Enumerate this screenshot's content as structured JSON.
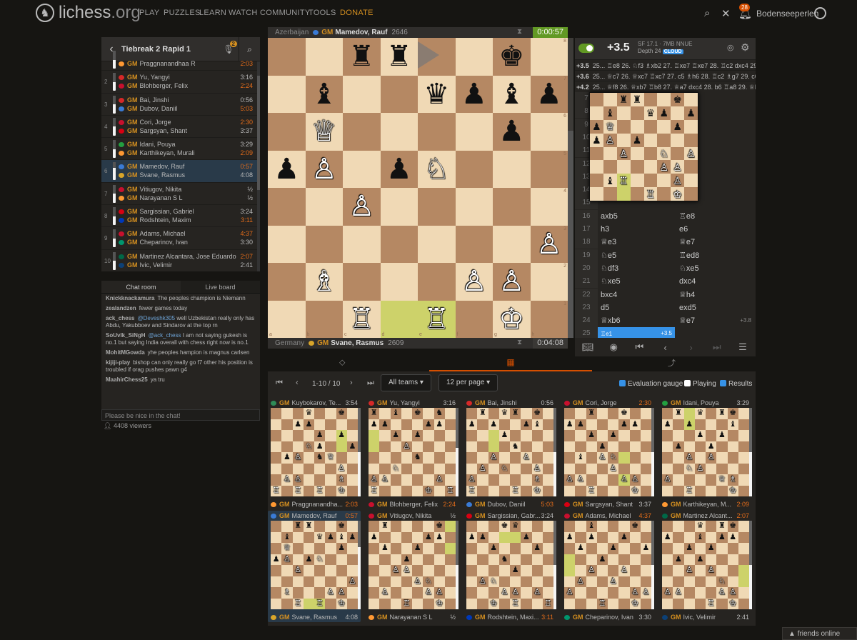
{
  "nav": {
    "logo_text": "lichess",
    "logo_suffix": ".org",
    "items": [
      "PLAY",
      "PUZZLES",
      "LEARN",
      "WATCH",
      "COMMUNITY",
      "TOOLS",
      "DONATE"
    ],
    "notification_count": "28",
    "username": "Bodenseeperlen"
  },
  "broadcast": {
    "title": "Tiebreak 2 Rapid 1",
    "mic_count": "2",
    "games": [
      {
        "num": "",
        "p1": "",
        "p1_time": "",
        "p2": "Praggnanandhaa R",
        "p2_time": "2:03",
        "p2_red": true,
        "eval": 0.5,
        "partial": true
      },
      {
        "num": "2",
        "p1": "Yu, Yangyi",
        "p1_time": "3:16",
        "p2": "Blohberger, Felix",
        "p2_time": "2:24",
        "p2_red": true,
        "eval": 0.5
      },
      {
        "num": "3",
        "p1": "Bai, Jinshi",
        "p1_time": "0:56",
        "p2": "Dubov, Daniil",
        "p2_time": "5:03",
        "p2_red": true,
        "eval": 0.5
      },
      {
        "num": "4",
        "p1": "Cori, Jorge",
        "p1_time": "2:30",
        "p1_red": true,
        "p2": "Sargsyan, Shant",
        "p2_time": "3:37",
        "eval": 0.5
      },
      {
        "num": "5",
        "p1": "Idani, Pouya",
        "p1_time": "3:29",
        "p2": "Karthikeyan, Murali",
        "p2_time": "2:09",
        "p2_red": true,
        "eval": 0.5
      },
      {
        "num": "6",
        "p1": "Mamedov, Rauf",
        "p1_time": "0:57",
        "p1_red": true,
        "p2": "Svane, Rasmus",
        "p2_time": "4:08",
        "eval": 0.3,
        "active": true
      },
      {
        "num": "7",
        "p1": "Vitiugov, Nikita",
        "p1_time": "½",
        "p2": "Narayanan S L",
        "p2_time": "½",
        "eval": 0.5
      },
      {
        "num": "8",
        "p1": "Sargissian, Gabriel",
        "p1_time": "3:24",
        "p2": "Rodshtein, Maxim",
        "p2_time": "3:11",
        "p2_red": true,
        "eval": 0.5
      },
      {
        "num": "9",
        "p1": "Adams, Michael",
        "p1_time": "4:37",
        "p1_red": true,
        "p2": "Cheparinov, Ivan",
        "p2_time": "3:30",
        "eval": 0.5
      },
      {
        "num": "10",
        "p1": "Martinez Alcantara, Jose Eduardo",
        "p1_time": "2:07",
        "p1_red": true,
        "p2": "Ivic, Velimir",
        "p2_time": "2:41",
        "eval": 0.5
      }
    ],
    "gm": "GM"
  },
  "chat": {
    "tab_chat": "Chat room",
    "tab_live": "Live board",
    "messages": [
      {
        "user": "Knickknackamura",
        "text": "The peoples champion is Niemann"
      },
      {
        "user": "zealandzen",
        "text": "fewer games today"
      },
      {
        "user": "ack_chess",
        "mention": "@Deveshk305",
        "text": "well Uzbekistan really only has Abdu, Yakubboev and Sindarov at the top rn"
      },
      {
        "user": "SoUvIk_SiNgH",
        "mention": "@ack_chess",
        "text": "I am not saying gukesh is no.1 but saying India overall with chess right now is no.1"
      },
      {
        "user": "MohitMGowda",
        "text": "yhe peoples hampion is magnus carlsen"
      },
      {
        "user": "kijiji-play",
        "text": "bishop can only really go f7 other his position is troubled if orag pushes pawn g4"
      },
      {
        "user": "MaahirChess25",
        "text": "ya tru"
      }
    ],
    "placeholder": "Please be nice in the chat!",
    "viewers": "4408 viewers"
  },
  "board": {
    "top": {
      "country": "Azerbaijan",
      "title": "GM",
      "name": "Mamedov, Rauf",
      "rating": "2646",
      "clock": "0:00:57"
    },
    "bottom": {
      "country": "Germany",
      "title": "GM",
      "name": "Svane, Rasmus",
      "rating": "2609",
      "clock": "0:04:08"
    },
    "ranks": [
      "8",
      "7",
      "6",
      "5",
      "4",
      "3",
      "2",
      "1"
    ],
    "files": [
      "a",
      "b",
      "c",
      "d",
      "e",
      "f",
      "g",
      "h"
    ]
  },
  "engine": {
    "eval": "+3.5",
    "name": "SF 17.1 · 7MB",
    "nnue": "NNUE",
    "depth": "Depth 24",
    "cloud": "CLOUD",
    "lines": [
      {
        "eval": "+3.5",
        "moves": "25... ♖e8 26. ♘f3 ♗xb2 27. ♖xe7 ♖xe7 28. ♖c2 dxc4 29. ♗xc4"
      },
      {
        "eval": "+3.6",
        "moves": "25... ♕c7 26. ♕xc7 ♖xc7 27. c5 ♗h6 28. ♖c2 ♗g7 29. c6"
      },
      {
        "eval": "+4.2",
        "moves": "25... ♕f8 26. ♕xb7 ♖b8 27. ♕a7 dxc4 28. b6 ♖a8 29. ♕b"
      }
    ]
  },
  "moves": [
    {
      "n": "7",
      "w": "",
      "b": ""
    },
    {
      "n": "8",
      "w": "",
      "b": ""
    },
    {
      "n": "9",
      "w": "",
      "b": ""
    },
    {
      "n": "10",
      "w": "",
      "b": ""
    },
    {
      "n": "11",
      "w": "",
      "b": ""
    },
    {
      "n": "12",
      "w": "",
      "b": ""
    },
    {
      "n": "13",
      "w": "",
      "b": ""
    },
    {
      "n": "14",
      "w": "",
      "b": ""
    },
    {
      "n": "15",
      "w": "",
      "b": ""
    },
    {
      "n": "16",
      "w": "axb5",
      "b": "♖e8"
    },
    {
      "n": "17",
      "w": "h3",
      "b": "e6"
    },
    {
      "n": "18",
      "w": "♕e3",
      "b": "♕e7"
    },
    {
      "n": "19",
      "w": "♘e5",
      "b": "♖ed8"
    },
    {
      "n": "20",
      "w": "♘df3",
      "b": "♘xe5"
    },
    {
      "n": "21",
      "w": "♘xe5",
      "b": "dxc4"
    },
    {
      "n": "22",
      "w": "bxc4",
      "b": "♕h4"
    },
    {
      "n": "23",
      "w": "d5",
      "b": "exd5"
    },
    {
      "n": "24",
      "w": "♕xb6",
      "b": "♕e7",
      "ev": "+3.8"
    },
    {
      "n": "25",
      "w": "♖e1",
      "b": "",
      "ev": "+3.5",
      "current": true
    }
  ],
  "grid": {
    "pager": "1-10 / 10",
    "teams": "All teams",
    "per_page": "12 per page",
    "eval_gauge": "Evaluation gauge",
    "playing": "Playing",
    "results": "Results"
  },
  "tiles": [
    {
      "top": "Kuybokarov, Te...",
      "top_time": "3:54",
      "bot": "Praggnanandha...",
      "bot_time": "2:03",
      "bot_red": true,
      "gauge": 0.5
    },
    {
      "top": "Yu, Yangyi",
      "top_time": "3:16",
      "bot": "Blohberger, Felix",
      "bot_time": "2:24",
      "bot_red": true,
      "gauge": 0.45
    },
    {
      "top": "Bai, Jinshi",
      "top_time": "0:56",
      "bot": "Dubov, Daniil",
      "bot_time": "5:03",
      "bot_red": true,
      "gauge": 0.5
    },
    {
      "top": "Cori, Jorge",
      "top_time": "2:30",
      "top_red": true,
      "bot": "Sargsyan, Shant",
      "bot_time": "3:37",
      "gauge": 0.5
    },
    {
      "top": "Idani, Pouya",
      "top_time": "3:29",
      "bot": "Karthikeyan, M...",
      "bot_time": "2:09",
      "bot_red": true,
      "gauge": 0.5
    },
    {
      "top": "Mamedov, Rauf",
      "top_time": "0:57",
      "top_red": true,
      "bot": "Svane, Rasmus",
      "bot_time": "4:08",
      "gauge": 0.3,
      "active": true
    },
    {
      "top": "Vitiugov, Nikita",
      "top_time": "½",
      "bot": "Narayanan S L",
      "bot_time": "½",
      "gauge": 0.5
    },
    {
      "top": "Sargissian, Gabr...",
      "top_time": "3:24",
      "bot": "Rodshtein, Maxi...",
      "bot_time": "3:11",
      "bot_red": true,
      "gauge": 0.5
    },
    {
      "top": "Adams, Michael",
      "top_time": "4:37",
      "top_red": true,
      "bot": "Cheparinov, Ivan",
      "bot_time": "3:30",
      "gauge": 0.5
    },
    {
      "top": "Martinez Alcant...",
      "top_time": "2:07",
      "top_red": true,
      "bot": "Ivic, Velimir",
      "bot_time": "2:41",
      "gauge": 0.5
    }
  ],
  "friends": "friends online",
  "colors": {
    "accent": "#d59020",
    "live": "#629924",
    "blue": "#3692e7",
    "orange": "#d64f00"
  }
}
